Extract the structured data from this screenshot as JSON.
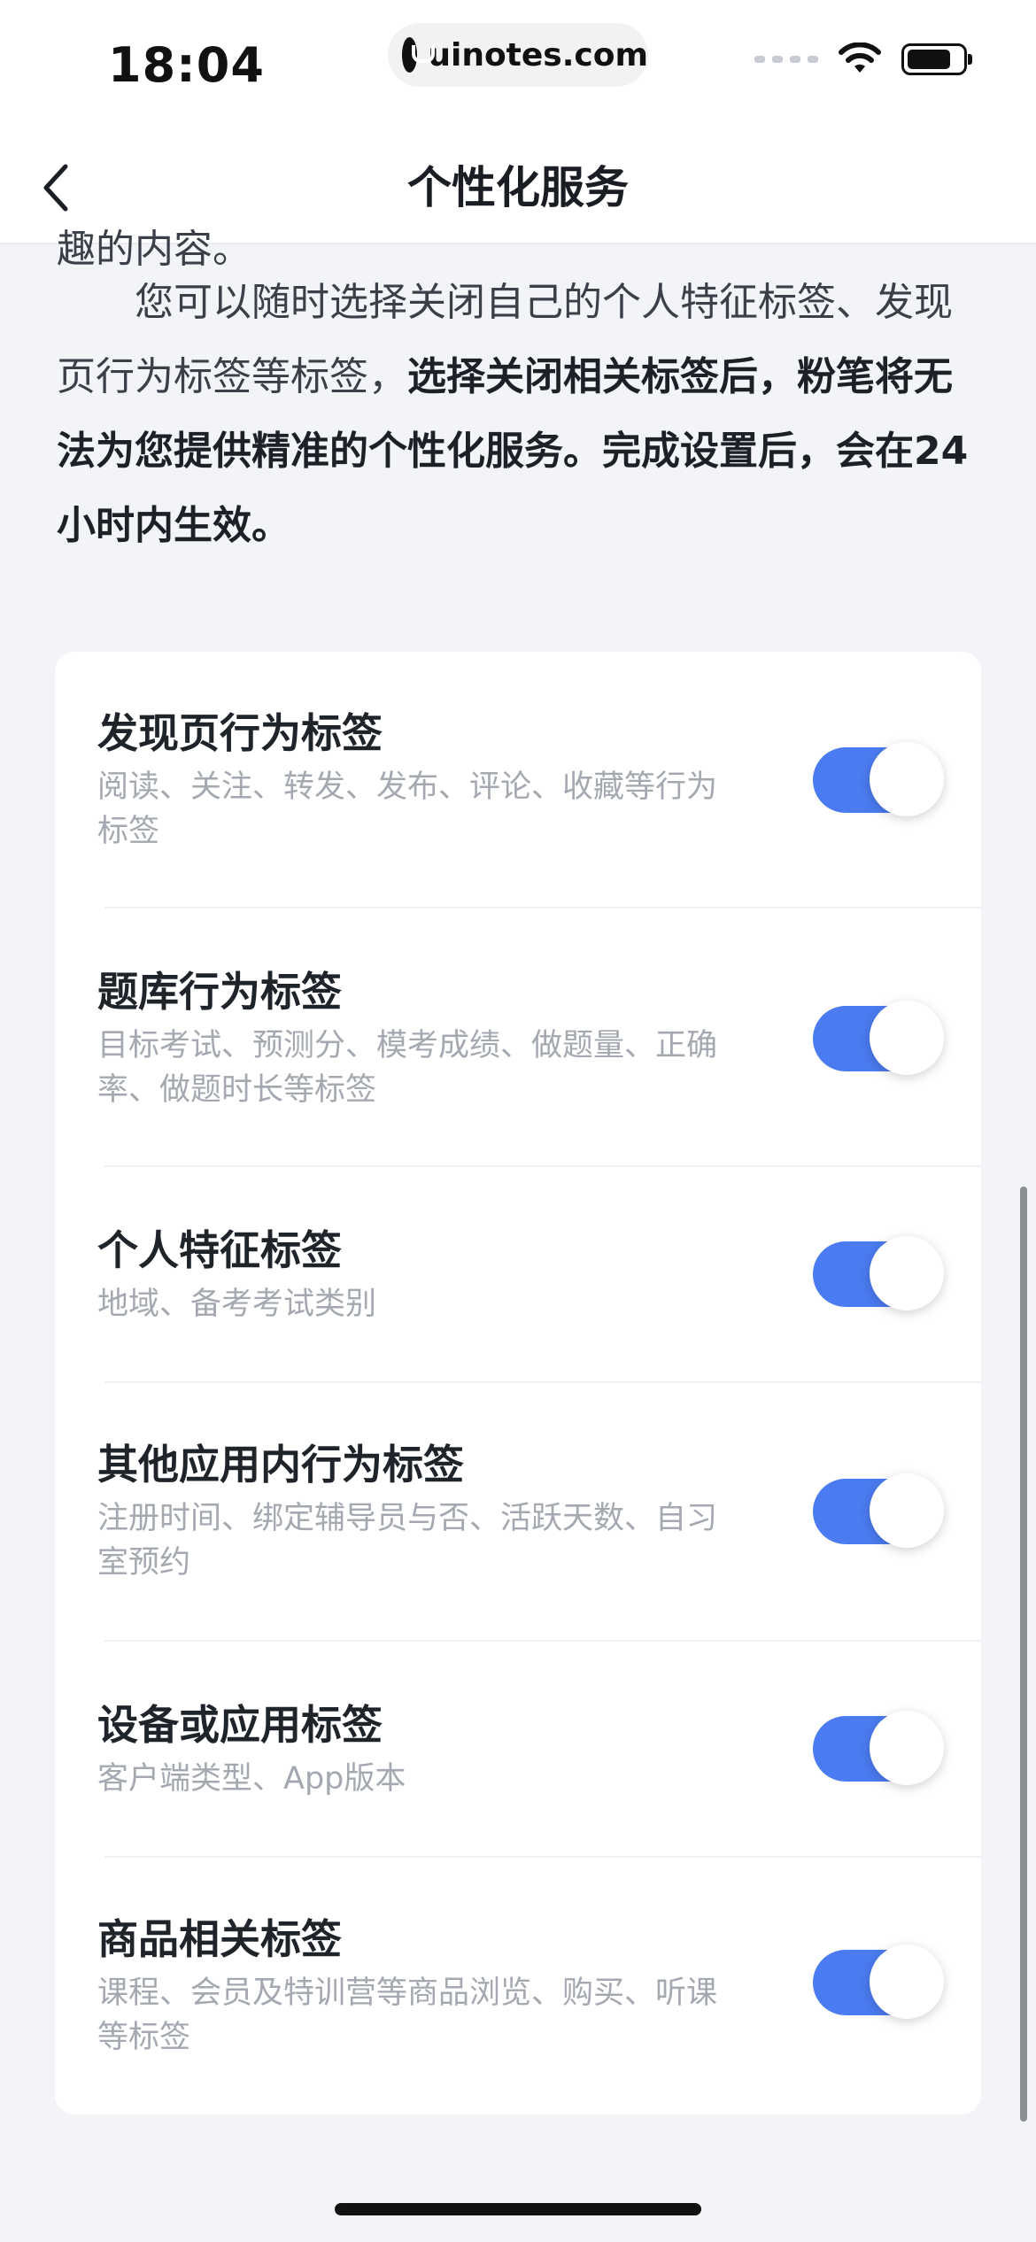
{
  "status_bar": {
    "time": "18:04",
    "url": "uinotes.com"
  },
  "nav": {
    "title": "个性化服务"
  },
  "intro": {
    "clipped_line": "趣的内容。",
    "paragraph_normal": "您可以随时选择关闭自己的个人特征标签、发现页行为标签等标签，",
    "paragraph_bold": "选择关闭相关标签后，粉笔将无法为您提供精准的个性化服务。完成设置后，会在24小时内生效。"
  },
  "settings": [
    {
      "title": "发现页行为标签",
      "desc": "阅读、关注、转发、发布、评论、收藏等行为标签",
      "enabled": true
    },
    {
      "title": "题库行为标签",
      "desc": "目标考试、预测分、模考成绩、做题量、正确率、做题时长等标签",
      "enabled": true
    },
    {
      "title": "个人特征标签",
      "desc": "地域、备考考试类别",
      "enabled": true
    },
    {
      "title": "其他应用内行为标签",
      "desc": "注册时间、绑定辅导员与否、活跃天数、自习室预约",
      "enabled": true
    },
    {
      "title": "设备或应用标签",
      "desc": "客户端类型、App版本",
      "enabled": true
    },
    {
      "title": "商品相关标签",
      "desc": "课程、会员及特训营等商品浏览、购买、听课等标签",
      "enabled": true
    }
  ],
  "colors": {
    "accent": "#4b7bf0",
    "background": "#f3f4f8",
    "card": "#ffffff"
  }
}
